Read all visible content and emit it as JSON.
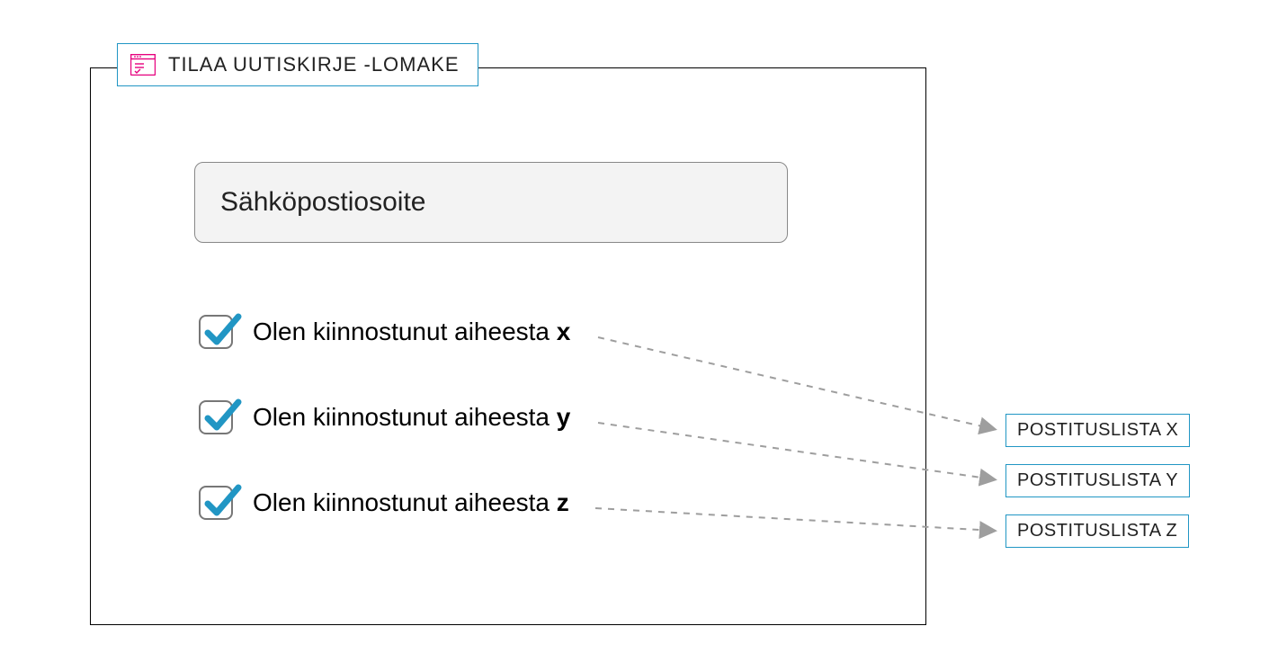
{
  "form": {
    "title": "TILAA UUTISKIRJE -LOMAKE",
    "email_placeholder": "Sähköpostiosoite",
    "checkboxes": [
      {
        "label_prefix": "Olen kiinnostunut aiheesta ",
        "label_bold": "x"
      },
      {
        "label_prefix": "Olen kiinnostunut aiheesta ",
        "label_bold": "y"
      },
      {
        "label_prefix": "Olen kiinnostunut aiheesta ",
        "label_bold": "z"
      }
    ]
  },
  "mailing_lists": [
    {
      "label": "POSTITUSLISTA X"
    },
    {
      "label": "POSTITUSLISTA Y"
    },
    {
      "label": "POSTITUSLISTA Z"
    }
  ]
}
